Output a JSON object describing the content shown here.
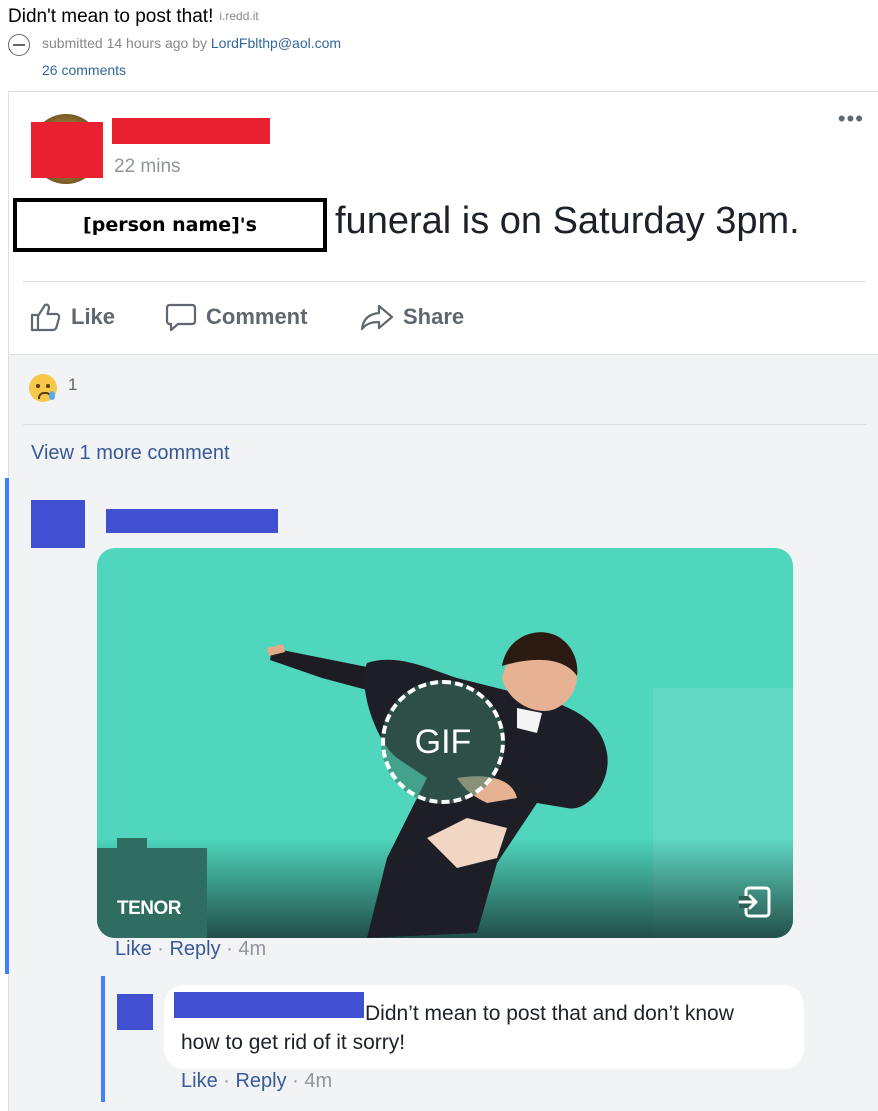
{
  "reddit": {
    "title": "Didn't mean to post that!",
    "domain": "i.redd.it",
    "submitted_prefix": "submitted 14 hours ago by ",
    "author": "LordFblthp@aol.com",
    "comments_link": "26 comments"
  },
  "post": {
    "time": "22 mins",
    "name_placeholder": "[person name]'s",
    "text": "funeral is on Saturday 3pm.",
    "more_icon": "ellipsis-icon",
    "redaction_color": "#e8202f"
  },
  "actions": {
    "like": "Like",
    "comment": "Comment",
    "share": "Share"
  },
  "reactions": {
    "icon": "sad-emoji-icon",
    "count": "1"
  },
  "comments": {
    "view_more": "View 1 more comment",
    "redaction_color": "#4050d0",
    "gif_comment": {
      "gif_label": "GIF",
      "provider": "TENOR",
      "like": "Like",
      "sep": " · ",
      "reply": "Reply",
      "time": "4m"
    },
    "reply_comment": {
      "text_line1": "Didn’t mean to post that and don’t know",
      "text_line2": "how to get rid of it sorry!",
      "like": "Like",
      "sep": " · ",
      "reply": "Reply",
      "time": "4m"
    }
  },
  "colors": {
    "link_blue": "#385898",
    "thread_bar": "#4080ff",
    "gif_background": "#4fd6bd"
  }
}
